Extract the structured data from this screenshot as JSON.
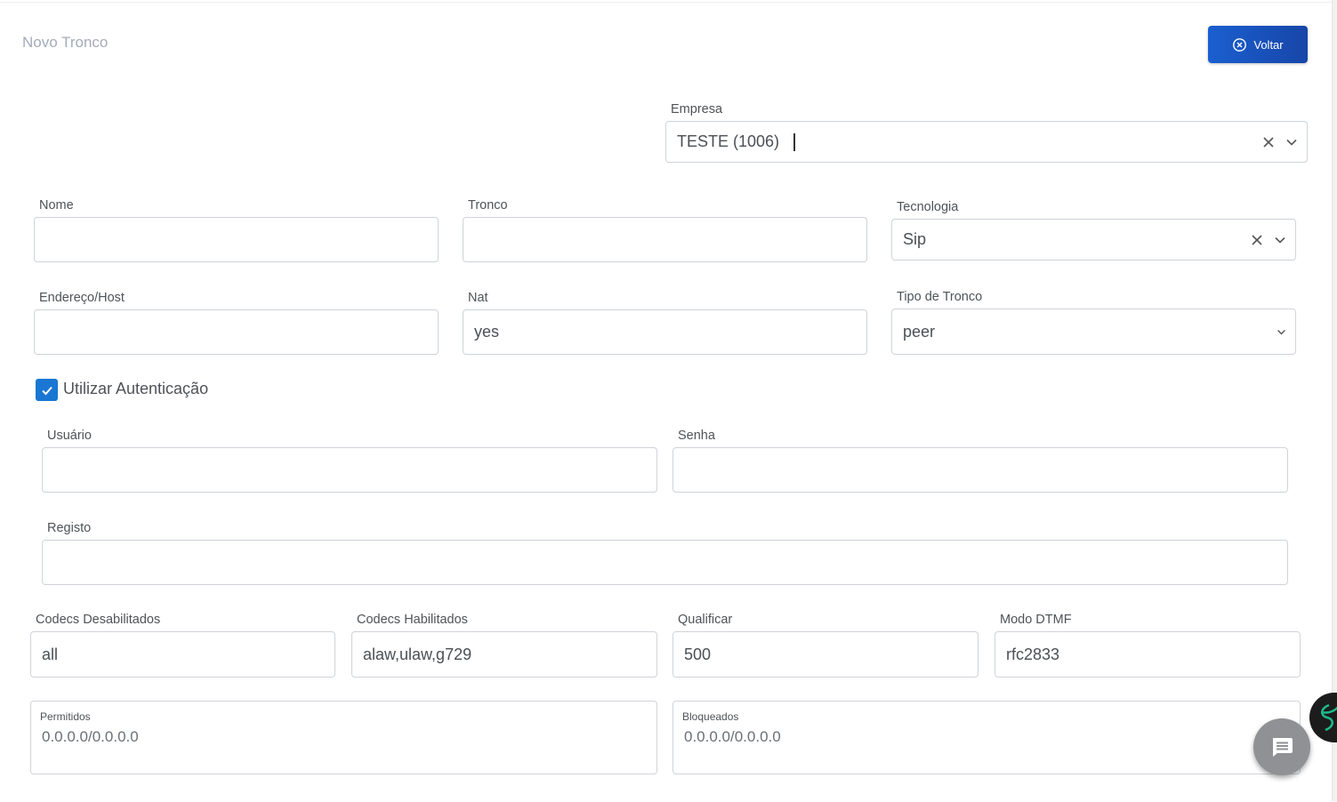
{
  "page": {
    "title": "Novo Tronco"
  },
  "toolbar": {
    "back_label": "Voltar"
  },
  "empresa": {
    "label": "Empresa",
    "value": "TESTE (1006)"
  },
  "nome": {
    "label": "Nome",
    "value": ""
  },
  "tronco": {
    "label": "Tronco",
    "value": ""
  },
  "tecnologia": {
    "label": "Tecnologia",
    "value": "Sip"
  },
  "host": {
    "label": "Endereço/Host",
    "value": ""
  },
  "nat": {
    "label": "Nat",
    "value": "yes"
  },
  "tipo_tronco": {
    "label": "Tipo de Tronco",
    "value": "peer"
  },
  "auth": {
    "label": "Utilizar Autenticação",
    "checked": true
  },
  "usuario": {
    "label": "Usuário",
    "value": ""
  },
  "senha": {
    "label": "Senha",
    "value": ""
  },
  "registo": {
    "label": "Registo",
    "value": ""
  },
  "codecs_desab": {
    "label": "Codecs Desabilitados",
    "value": "all"
  },
  "codecs_hab": {
    "label": "Codecs Habilitados",
    "value": "alaw,ulaw,g729"
  },
  "qualificar": {
    "label": "Qualificar",
    "value": "500"
  },
  "dtmf": {
    "label": "Modo DTMF",
    "value": "rfc2833"
  },
  "permitidos": {
    "label": "Permitidos",
    "value": "0.0.0.0/0.0.0.0"
  },
  "bloqueados": {
    "label": "Bloqueados",
    "value": "0.0.0.0/0.0.0.0"
  },
  "colors": {
    "primary": "#1976d2",
    "button": "#1a5fd0",
    "border": "#cfd3d8"
  }
}
